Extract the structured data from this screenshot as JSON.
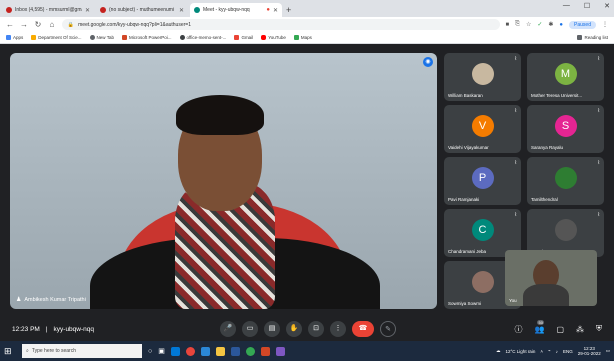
{
  "browser": {
    "tabs": [
      {
        "label": "Inbox (4,595) - mmsurml@gmai",
        "color": "#c5221f",
        "active": false
      },
      {
        "label": "(no subject) - muthumeenumi",
        "color": "#c5221f",
        "active": false
      },
      {
        "label": "Meet - kyy-ubqw-nqq",
        "color": "#00897b",
        "active": true
      }
    ],
    "new_tab": "+",
    "url": "meet.google.com/kyy-ubqw-nqq?pli=1&authuser=1",
    "paused_label": "Paused",
    "bookmarks": [
      {
        "label": "Apps",
        "color": "#4285f4"
      },
      {
        "label": "Department Of Scie...",
        "color": "#f9ab00"
      },
      {
        "label": "New Tab",
        "color": "#5f6368"
      },
      {
        "label": "Microsoft PowerPoi...",
        "color": "#d24726"
      },
      {
        "label": "office-memo-sent-...",
        "color": "#3c4043"
      },
      {
        "label": "Gmail",
        "color": "#ea4335"
      },
      {
        "label": "YouTube",
        "color": "#ff0000"
      },
      {
        "label": "Maps",
        "color": "#34a853"
      }
    ],
    "reading_list": "Reading list"
  },
  "meet": {
    "presenter_name": "Ambikesh Kumar Tripathi",
    "participants": [
      {
        "name": "William Baskaran",
        "initial": "",
        "color": "#c8b8a0"
      },
      {
        "name": "Mother Teresa Universit...",
        "initial": "M",
        "color": "#7cb342"
      },
      {
        "name": "Vaidehi Vijayakumar",
        "initial": "V",
        "color": "#f57c00"
      },
      {
        "name": "Saranya Rayalu",
        "initial": "S",
        "color": "#e52592"
      },
      {
        "name": "Pavi Ramjanaki",
        "initial": "P",
        "color": "#5c6bc0"
      },
      {
        "name": "Tamilthendral",
        "initial": "",
        "color": "#2e7d32"
      },
      {
        "name": "Chandramani Jeba",
        "initial": "C",
        "color": "#00897b"
      },
      {
        "name": "Manoj ...",
        "initial": "",
        "color": "#555"
      },
      {
        "name": "Sowmiya Sowmi",
        "initial": "",
        "color": "#8d6e63"
      }
    ],
    "self_label": "You",
    "time": "12:23 PM",
    "separator": "|",
    "meeting_code": "kyy-ubqw-nqq",
    "people_count": "50"
  },
  "taskbar": {
    "search_placeholder": "Type here to search",
    "weather": "12°C Light rain",
    "language": "ENG",
    "time": "12:23",
    "date": "29-01-2022"
  }
}
